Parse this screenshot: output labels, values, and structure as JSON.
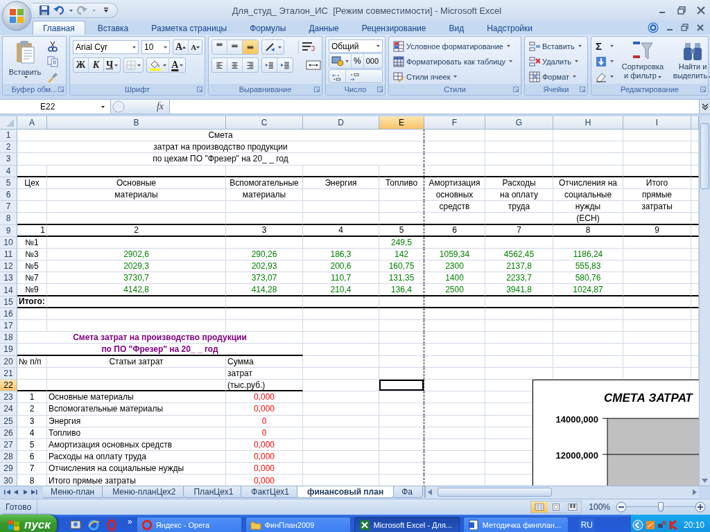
{
  "window": {
    "title": "Для_студ_ Эталон_ИС  [Режим совместимости] - Microsoft Excel"
  },
  "ribbon_tabs": [
    {
      "label": "Главная",
      "selected": true
    },
    {
      "label": "Вставка",
      "selected": false
    },
    {
      "label": "Разметка страницы",
      "selected": false
    },
    {
      "label": "Формулы",
      "selected": false
    },
    {
      "label": "Данные",
      "selected": false
    },
    {
      "label": "Рецензирование",
      "selected": false
    },
    {
      "label": "Вид",
      "selected": false
    },
    {
      "label": "Надстройки",
      "selected": false
    }
  ],
  "ribbon": {
    "clipboard": {
      "paste": "Вставить",
      "group": "Буфер обм..."
    },
    "font": {
      "name": "Arial Cyr",
      "size": "10",
      "grow": "A",
      "shrink": "A",
      "bold": "Ж",
      "italic": "К",
      "underline": "Ч",
      "color_letter": "A",
      "group": "Шрифт"
    },
    "alignment": {
      "vertical": [
        {
          "selected": false
        },
        {
          "selected": false
        },
        {
          "selected": true
        }
      ],
      "horizontal": [
        {
          "selected": false
        },
        {
          "selected": false
        },
        {
          "selected": false
        }
      ],
      "group": "Выравнивание"
    },
    "number": {
      "format": "Общий",
      "percent": "%",
      "thousands": "000",
      "group": "Число"
    },
    "styles": {
      "items": [
        "Условное форматирование",
        "Форматировать как таблицу",
        "Стили ячеек"
      ],
      "group": "Стили"
    },
    "cells": {
      "items": [
        "Вставить",
        "Удалить",
        "Формат"
      ],
      "group": "Ячейки"
    },
    "editing": {
      "sum": "Σ",
      "sort": "Сортировка и фильтр",
      "find": "Найти и выделить",
      "group": "Редактирование"
    }
  },
  "formula_bar": {
    "name_box": "E22",
    "function_label": "fx"
  },
  "sheet": {
    "columns": [
      {
        "label": "A",
        "selected": false,
        "page_break": false
      },
      {
        "label": "B",
        "selected": false,
        "page_break": false
      },
      {
        "label": "C",
        "selected": false,
        "page_break": false
      },
      {
        "label": "D",
        "selected": false,
        "page_break": false
      },
      {
        "label": "E",
        "selected": true,
        "page_break": true
      },
      {
        "label": "F",
        "selected": false,
        "page_break": false
      },
      {
        "label": "G",
        "selected": false,
        "page_break": false
      },
      {
        "label": "H",
        "selected": false,
        "page_break": false
      },
      {
        "label": "I",
        "selected": false,
        "page_break": false
      }
    ],
    "rows": [
      {
        "label": "1",
        "kind": "grid",
        "selected": false,
        "rule_below": false,
        "cells": [
          {
            "kind": "title",
            "text": "Смета"
          }
        ]
      },
      {
        "label": "2",
        "kind": "grid",
        "selected": false,
        "rule_below": false,
        "cells": [
          {
            "kind": "title",
            "text": "затрат на производство продукции"
          }
        ]
      },
      {
        "label": "3",
        "kind": "grid",
        "selected": false,
        "rule_below": false,
        "cells": [
          {
            "kind": "title",
            "text": "по цехам ПО \"Фрезер\" на 20_ _ год"
          }
        ]
      },
      {
        "label": "4",
        "kind": "grid",
        "selected": false,
        "rule_below": true,
        "cells": []
      },
      {
        "label": "5",
        "kind": "grid",
        "selected": false,
        "rule_below": false,
        "cells": [
          {
            "kind": "head",
            "text": "Цех"
          },
          {
            "kind": "head",
            "text": "Основные"
          },
          {
            "kind": "head",
            "text": "Вспомогательные"
          },
          {
            "kind": "head",
            "text": "Энергия"
          },
          {
            "kind": "head",
            "text": "Топливо"
          },
          {
            "kind": "head",
            "text": "Амортизация"
          },
          {
            "kind": "head",
            "text": "Расходы"
          },
          {
            "kind": "head",
            "text": "Отчисления на"
          },
          {
            "kind": "head",
            "text": "Итого"
          }
        ]
      },
      {
        "label": "6",
        "kind": "grid",
        "selected": false,
        "rule_below": false,
        "cells": [
          {
            "kind": "empty"
          },
          {
            "kind": "head",
            "text": "материалы"
          },
          {
            "kind": "head",
            "text": "материалы"
          },
          {
            "kind": "empty"
          },
          {
            "kind": "empty"
          },
          {
            "kind": "head",
            "text": "основных"
          },
          {
            "kind": "head",
            "text": "на оплату"
          },
          {
            "kind": "head",
            "text": "социальные"
          },
          {
            "kind": "head",
            "text": "прямые"
          }
        ]
      },
      {
        "label": "7",
        "kind": "grid",
        "selected": false,
        "rule_below": false,
        "cells": [
          {
            "kind": "empty"
          },
          {
            "kind": "empty"
          },
          {
            "kind": "empty"
          },
          {
            "kind": "empty"
          },
          {
            "kind": "empty"
          },
          {
            "kind": "head",
            "text": "средств"
          },
          {
            "kind": "head",
            "text": "труда"
          },
          {
            "kind": "head",
            "text": "нужды"
          },
          {
            "kind": "head",
            "text": "затраты"
          }
        ]
      },
      {
        "label": "8",
        "kind": "grid",
        "selected": false,
        "rule_below": true,
        "cells": [
          {
            "kind": "empty"
          },
          {
            "kind": "empty"
          },
          {
            "kind": "empty"
          },
          {
            "kind": "empty"
          },
          {
            "kind": "empty"
          },
          {
            "kind": "empty"
          },
          {
            "kind": "empty"
          },
          {
            "kind": "head",
            "text": "(ЕСН)"
          }
        ]
      },
      {
        "label": "9",
        "kind": "grid",
        "selected": false,
        "rule_below": true,
        "cells": [
          {
            "kind": "right",
            "text": "1"
          },
          {
            "kind": "head",
            "text": "2"
          },
          {
            "kind": "head",
            "text": "3"
          },
          {
            "kind": "head",
            "text": "4"
          },
          {
            "kind": "head",
            "text": "5"
          },
          {
            "kind": "head",
            "text": "6"
          },
          {
            "kind": "head",
            "text": "7"
          },
          {
            "kind": "head",
            "text": "8"
          },
          {
            "kind": "head",
            "text": "9"
          }
        ]
      },
      {
        "label": "10",
        "kind": "grid",
        "selected": false,
        "rule_below": false,
        "cells": [
          {
            "kind": "head",
            "text": "№1"
          },
          {
            "kind": "empty"
          },
          {
            "kind": "empty"
          },
          {
            "kind": "empty"
          },
          {
            "kind": "input",
            "text": "249,5"
          }
        ]
      },
      {
        "label": "11",
        "kind": "grid",
        "selected": false,
        "rule_below": false,
        "cells": [
          {
            "kind": "head",
            "text": "№3"
          },
          {
            "kind": "input",
            "text": "2902,6"
          },
          {
            "kind": "input",
            "text": "290,26"
          },
          {
            "kind": "input",
            "text": "186,3"
          },
          {
            "kind": "input",
            "text": "142"
          },
          {
            "kind": "input",
            "text": "1059,34"
          },
          {
            "kind": "input",
            "text": "4562,45"
          },
          {
            "kind": "input",
            "text": "1186,24"
          }
        ]
      },
      {
        "label": "12",
        "kind": "grid",
        "selected": false,
        "rule_below": false,
        "cells": [
          {
            "kind": "head",
            "text": "№5"
          },
          {
            "kind": "input",
            "text": "2029,3"
          },
          {
            "kind": "input",
            "text": "202,93"
          },
          {
            "kind": "input",
            "text": "200,6"
          },
          {
            "kind": "input",
            "text": "160,75"
          },
          {
            "kind": "input",
            "text": "2300"
          },
          {
            "kind": "input",
            "text": "2137,8"
          },
          {
            "kind": "input",
            "text": "555,83"
          }
        ]
      },
      {
        "label": "13",
        "kind": "grid",
        "selected": false,
        "rule_below": false,
        "cells": [
          {
            "kind": "head",
            "text": "№7"
          },
          {
            "kind": "input",
            "text": "3730,7"
          },
          {
            "kind": "input",
            "text": "373,07"
          },
          {
            "kind": "input",
            "text": "110,7"
          },
          {
            "kind": "input",
            "text": "131,35"
          },
          {
            "kind": "input",
            "text": "1400"
          },
          {
            "kind": "input",
            "text": "2233,7"
          },
          {
            "kind": "input",
            "text": "580,76"
          }
        ]
      },
      {
        "label": "14",
        "kind": "grid",
        "selected": false,
        "rule_below": true,
        "cells": [
          {
            "kind": "head",
            "text": "№9"
          },
          {
            "kind": "input",
            "text": "4142,8"
          },
          {
            "kind": "input",
            "text": "414,28"
          },
          {
            "kind": "input",
            "text": "210,4"
          },
          {
            "kind": "input",
            "text": "136,4"
          },
          {
            "kind": "input",
            "text": "2500"
          },
          {
            "kind": "input",
            "text": "3941,8"
          },
          {
            "kind": "input",
            "text": "1024,87"
          }
        ]
      },
      {
        "label": "15",
        "kind": "grid",
        "selected": false,
        "rule_below": true,
        "cells": [
          {
            "kind": "total",
            "text": "Итого:"
          }
        ]
      },
      {
        "label": "16",
        "kind": "grid",
        "selected": false,
        "rule_below": false,
        "cells": []
      },
      {
        "label": "17",
        "kind": "grid",
        "selected": false,
        "rule_below": false,
        "cells": []
      },
      {
        "label": "18",
        "kind": "list",
        "selected": false,
        "rule_below": false,
        "cells": [
          {
            "kind": "caption",
            "text": "Смета затрат на производство продукции"
          }
        ]
      },
      {
        "label": "19",
        "kind": "list",
        "selected": false,
        "rule_below": true,
        "cells": [
          {
            "kind": "caption",
            "text": "по ПО \"Фрезер\" на 20_ _ год"
          }
        ]
      },
      {
        "label": "20",
        "kind": "list",
        "selected": false,
        "rule_below": false,
        "cells": [
          {
            "kind": "text",
            "text": "№ п/п"
          },
          {
            "kind": "head",
            "text": "Статьи затрат"
          },
          {
            "kind": "text",
            "text": "Сумма"
          }
        ]
      },
      {
        "label": "21",
        "kind": "list",
        "selected": false,
        "rule_below": false,
        "cells": [
          {
            "kind": "empty"
          },
          {
            "kind": "empty"
          },
          {
            "kind": "text",
            "text": "затрат"
          }
        ]
      },
      {
        "label": "22",
        "kind": "list",
        "selected": true,
        "rule_below": true,
        "cells": [
          {
            "kind": "empty"
          },
          {
            "kind": "empty"
          },
          {
            "kind": "text",
            "text": "(тыс.руб.)"
          }
        ]
      },
      {
        "label": "23",
        "kind": "list",
        "selected": false,
        "rule_below": false,
        "cells": [
          {
            "kind": "head",
            "text": "1"
          },
          {
            "kind": "text",
            "text": "Основные материалы"
          },
          {
            "kind": "result",
            "text": "0,000"
          }
        ]
      },
      {
        "label": "24",
        "kind": "list",
        "selected": false,
        "rule_below": false,
        "cells": [
          {
            "kind": "head",
            "text": "2"
          },
          {
            "kind": "text",
            "text": "Вспомогательные материалы"
          },
          {
            "kind": "result",
            "text": "0,000"
          }
        ]
      },
      {
        "label": "25",
        "kind": "list",
        "selected": false,
        "rule_below": false,
        "cells": [
          {
            "kind": "head",
            "text": "3"
          },
          {
            "kind": "text",
            "text": "Энергия"
          },
          {
            "kind": "result",
            "text": "0"
          }
        ]
      },
      {
        "label": "26",
        "kind": "list",
        "selected": false,
        "rule_below": false,
        "cells": [
          {
            "kind": "head",
            "text": "4"
          },
          {
            "kind": "text",
            "text": "Топливо"
          },
          {
            "kind": "result",
            "text": "0"
          }
        ]
      },
      {
        "label": "27",
        "kind": "list",
        "selected": false,
        "rule_below": false,
        "cells": [
          {
            "kind": "head",
            "text": "5"
          },
          {
            "kind": "text",
            "text": "Амортизация основных средств"
          },
          {
            "kind": "result",
            "text": "0,000"
          }
        ]
      },
      {
        "label": "28",
        "kind": "list",
        "selected": false,
        "rule_below": false,
        "cells": [
          {
            "kind": "head",
            "text": "6"
          },
          {
            "kind": "text",
            "text": "Расходы на оплату труда"
          },
          {
            "kind": "result",
            "text": "0,000"
          }
        ]
      },
      {
        "label": "29",
        "kind": "list",
        "selected": false,
        "rule_below": false,
        "cells": [
          {
            "kind": "head",
            "text": "7"
          },
          {
            "kind": "text",
            "text": "Отчисления на социальные нужды"
          },
          {
            "kind": "result",
            "text": "0,000"
          }
        ]
      },
      {
        "label": "30",
        "kind": "list",
        "selected": false,
        "rule_below": false,
        "cells": [
          {
            "kind": "head",
            "text": "8"
          },
          {
            "kind": "text",
            "text": "Итого прямые затраты"
          },
          {
            "kind": "result",
            "text": "0,000"
          }
        ]
      }
    ],
    "chart": {
      "title": "СМЕТА ЗАТРАТ",
      "y_tick_labels": [
        "14000,000",
        "12000,000"
      ]
    }
  },
  "sheet_tabs": [
    {
      "label": "Меню-план",
      "selected": false
    },
    {
      "label": "Меню-планЦех2",
      "selected": false
    },
    {
      "label": "ПланЦех1",
      "selected": false
    },
    {
      "label": "ФактЦех1",
      "selected": false
    },
    {
      "label": "финансовый план",
      "selected": true
    },
    {
      "label": "Фа",
      "selected": false
    }
  ],
  "status_bar": {
    "status": "Готово",
    "views": [
      {
        "selected": true
      },
      {
        "selected": false
      },
      {
        "selected": false
      }
    ],
    "zoom": {
      "reading": "100%",
      "level": 0.5
    }
  },
  "taskbar": {
    "start": "пуск",
    "more": "»",
    "tasks": [
      {
        "kind": "browser",
        "label": "Яндекс - Opera",
        "selected": false
      },
      {
        "kind": "folder",
        "label": "ФинПлан2009",
        "selected": false
      },
      {
        "kind": "spreadsheet",
        "label": "Microsoft Excel - Для...",
        "selected": true
      },
      {
        "kind": "document",
        "label": "Методичка финплан...",
        "selected": false
      }
    ],
    "language": "RU",
    "clock": "20:10"
  }
}
